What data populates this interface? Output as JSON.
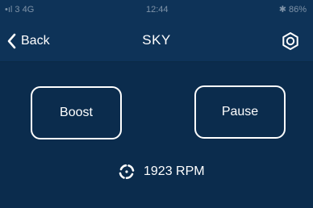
{
  "status_bar": {
    "carrier": "•ıl 3  4G",
    "time": "12:44",
    "battery": "✱ 86%"
  },
  "nav": {
    "back_label": "Back",
    "title": "SKY",
    "back_icon": "chevron-left-icon",
    "settings_icon": "gear-icon"
  },
  "controls": {
    "boost_label": "Boost",
    "pause_label": "Pause"
  },
  "fan": {
    "icon": "fan-icon",
    "rpm_text": "1923 RPM"
  },
  "colors": {
    "background": "#0b2c4d",
    "bar": "#0e3358",
    "foreground": "#ffffff"
  }
}
